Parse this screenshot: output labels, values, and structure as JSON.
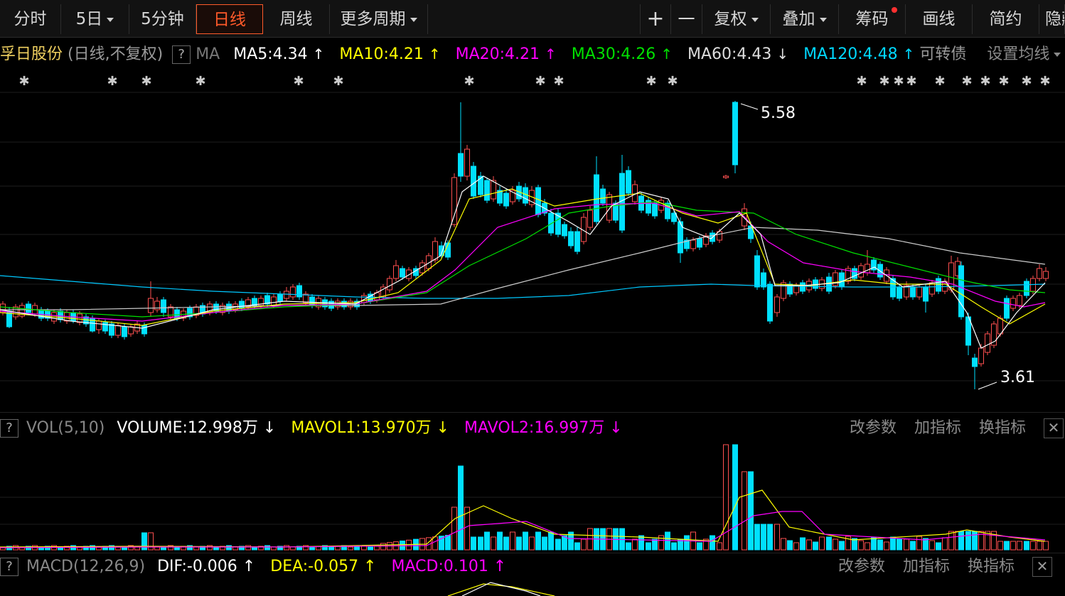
{
  "toolbar": {
    "tabs": [
      "分时",
      "5日",
      "5分钟",
      "日线",
      "周线",
      "更多周期"
    ],
    "active_tab": "日线",
    "right": [
      "+",
      "一",
      "复权",
      "叠加",
      "筹码",
      "画线",
      "简约",
      "隐藏"
    ]
  },
  "ma_bar": {
    "stock": "孚日股份",
    "mode": "(日线,不复权)",
    "help": "?",
    "label": "MA",
    "items": [
      {
        "text": "MA5:4.34",
        "arrow": "↑",
        "color": "#ffffff"
      },
      {
        "text": "MA10:4.21",
        "arrow": "↑",
        "color": "#ffff00"
      },
      {
        "text": "MA20:4.21",
        "arrow": "↑",
        "color": "#ff00ff"
      },
      {
        "text": "MA30:4.26",
        "arrow": "↑",
        "color": "#00e000"
      },
      {
        "text": "MA60:4.43",
        "arrow": "↓",
        "color": "#dddddd"
      },
      {
        "text": "MA120:4.48",
        "arrow": "↑",
        "color": "#00d8ff"
      }
    ],
    "extra": "可转债",
    "setting": "设置均线"
  },
  "price_labels": {
    "high": "5.58",
    "low": "3.61"
  },
  "vol_bar": {
    "help": "?",
    "label": "VOL(5,10)",
    "volume": "VOLUME:12.998万",
    "volume_arrow": "↓",
    "mavol1": "MAVOL1:13.970万",
    "mavol1_arrow": "↓",
    "mavol2": "MAVOL2:16.997万",
    "mavol2_arrow": "↓",
    "btns": [
      "改参数",
      "加指标",
      "换指标"
    ],
    "close": "✕"
  },
  "macd_bar": {
    "help": "?",
    "label": "MACD(12,26,9)",
    "dif": "DIF:-0.006",
    "dif_arrow": "↑",
    "dea": "DEA:-0.057",
    "dea_arrow": "↑",
    "macd": "MACD:0.101",
    "macd_arrow": "↑",
    "btns": [
      "改参数",
      "加指标",
      "换指标"
    ],
    "close": "✕"
  },
  "colors": {
    "up": "#ff5050",
    "down": "#00e0ff",
    "ma5": "#ffffff",
    "ma10": "#ffff00",
    "ma20": "#ff00ff",
    "ma30": "#00e000",
    "ma60": "#cccccc",
    "ma120": "#00c8ff"
  },
  "chart_data": {
    "type": "candlestick",
    "price_range": [
      3.61,
      5.58
    ],
    "candles_close_approx": [
      4.05,
      4.0,
      4.02,
      3.98,
      3.95,
      3.97,
      3.93,
      3.9,
      3.92,
      3.88,
      3.9,
      3.92,
      4.15,
      4.05,
      4.0,
      4.02,
      4.05,
      4.04,
      4.06,
      4.08,
      4.1,
      4.12,
      4.15,
      4.1,
      4.08,
      4.06,
      4.05,
      4.07,
      4.1,
      4.12,
      4.2,
      4.35,
      4.4,
      4.38,
      4.42,
      4.5,
      4.7,
      4.95,
      5.25,
      5.2,
      5.1,
      5.0,
      5.05,
      4.95,
      4.9,
      4.98,
      4.85,
      4.75,
      4.7,
      4.8,
      4.9,
      5.05,
      5.0,
      4.95,
      4.9,
      4.85,
      4.7,
      4.65,
      4.7,
      4.75,
      4.72,
      4.9,
      5.2,
      4.7,
      4.6,
      4.45,
      4.3,
      4.2,
      4.15,
      4.2,
      4.25,
      4.28,
      4.3,
      4.35,
      4.32,
      4.3,
      4.25,
      4.2,
      4.22,
      4.25,
      4.28,
      4.3,
      3.9,
      3.75,
      3.85,
      4.0,
      4.1,
      4.2,
      4.3,
      4.34
    ]
  }
}
